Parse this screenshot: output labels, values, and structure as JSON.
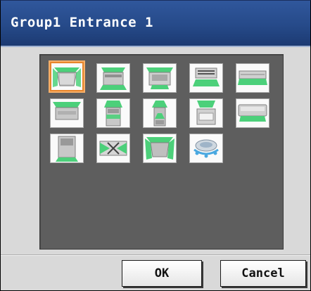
{
  "dialog": {
    "title": "Group1 Entrance 1"
  },
  "icon_grid": [
    {
      "name": "4-way-cassette-icon",
      "selected": true
    },
    {
      "name": "2-way-cassette-icon",
      "selected": false
    },
    {
      "name": "1-way-cassette-icon",
      "selected": false
    },
    {
      "name": "ceiling-concealed-icon",
      "selected": false
    },
    {
      "name": "wall-mounted-slim-icon",
      "selected": false
    },
    {
      "name": "ceiling-suspended-icon",
      "selected": false
    },
    {
      "name": "floor-standing-up-icon",
      "selected": false
    },
    {
      "name": "floor-standing-tall-icon",
      "selected": false
    },
    {
      "name": "floor-console-icon",
      "selected": false
    },
    {
      "name": "wall-mounted-icon",
      "selected": false
    },
    {
      "name": "floor-standing-cabinet-icon",
      "selected": false
    },
    {
      "name": "lossnay-ventilation-icon",
      "selected": false
    },
    {
      "name": "cassette-down-icon",
      "selected": false
    },
    {
      "name": "round-ceiling-fan-icon",
      "selected": false
    }
  ],
  "buttons": {
    "ok_label": "OK",
    "cancel_label": "Cancel"
  },
  "colors": {
    "title_bar": "#264a89",
    "selection": "#e8862c",
    "airflow": "#4cd07a"
  }
}
